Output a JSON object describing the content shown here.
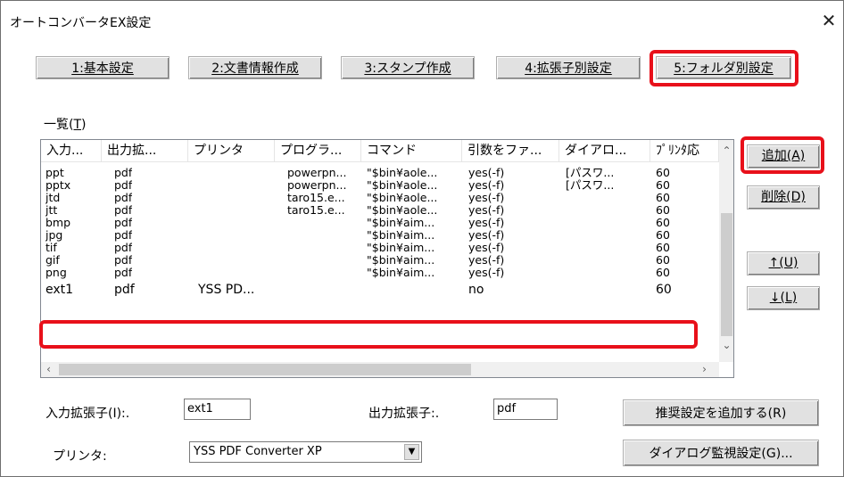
{
  "window": {
    "title": "オートコンバータEX設定",
    "close_glyph": "✕"
  },
  "tabs": [
    {
      "key": "1",
      "label": "1:基本設定"
    },
    {
      "key": "2",
      "label": "2:文書情報作成"
    },
    {
      "key": "3",
      "label": "3:スタンプ作成"
    },
    {
      "key": "4",
      "label": "4:拡張子別設定"
    },
    {
      "key": "5",
      "label": "5:フォルダ別設定"
    }
  ],
  "list": {
    "label": "一覧(",
    "label_key": "T",
    "label_end": ")",
    "columns": [
      "入力...",
      "出力拡...",
      "プリンタ",
      "プログラ...",
      "コマンド",
      "引数をファ...",
      "ダイアロ...",
      "ﾌﾟﾘﾝﾀ応"
    ],
    "rows": [
      [
        "ppt",
        "pdf",
        "",
        "powerpn...",
        "\"$bin¥aole...",
        "yes(-f)",
        "[パスワ...",
        "60"
      ],
      [
        "pptx",
        "pdf",
        "",
        "powerpn...",
        "\"$bin¥aole...",
        "yes(-f)",
        "[パスワ...",
        "60"
      ],
      [
        "jtd",
        "pdf",
        "",
        "taro15.e...",
        "\"$bin¥aole...",
        "yes(-f)",
        "",
        "60"
      ],
      [
        "jtt",
        "pdf",
        "",
        "taro15.e...",
        "\"$bin¥aole...",
        "yes(-f)",
        "",
        "60"
      ],
      [
        "bmp",
        "pdf",
        "",
        "",
        "\"$bin¥aim...",
        "yes(-f)",
        "",
        "60"
      ],
      [
        "jpg",
        "pdf",
        "",
        "",
        "\"$bin¥aim...",
        "yes(-f)",
        "",
        "60"
      ],
      [
        "tif",
        "pdf",
        "",
        "",
        "\"$bin¥aim...",
        "yes(-f)",
        "",
        "60"
      ],
      [
        "gif",
        "pdf",
        "",
        "",
        "\"$bin¥aim...",
        "yes(-f)",
        "",
        "60"
      ],
      [
        "png",
        "pdf",
        "",
        "",
        "\"$bin¥aim...",
        "yes(-f)",
        "",
        "60"
      ],
      [
        "ext1",
        "pdf",
        "YSS PD...",
        "",
        "",
        "no",
        "",
        "60"
      ]
    ]
  },
  "side_buttons": {
    "add": "追加(A)",
    "delete": "削除(D)",
    "up": "↑(U)",
    "down": "↓(L)"
  },
  "form": {
    "input_ext_label": "入力拡張子(I):.",
    "input_ext_value": "ext1",
    "output_ext_label": "出力拡張子:.",
    "output_ext_value": "pdf",
    "printer_label": "プリンタ:",
    "printer_value": "YSS PDF Converter XP",
    "recommended_button": "推奨設定を追加する(R)",
    "dialog_monitor_button": "ダイアログ監視設定(G)..."
  },
  "colors": {
    "highlight": "#e8101a",
    "button_face": "#e1e1e1"
  }
}
